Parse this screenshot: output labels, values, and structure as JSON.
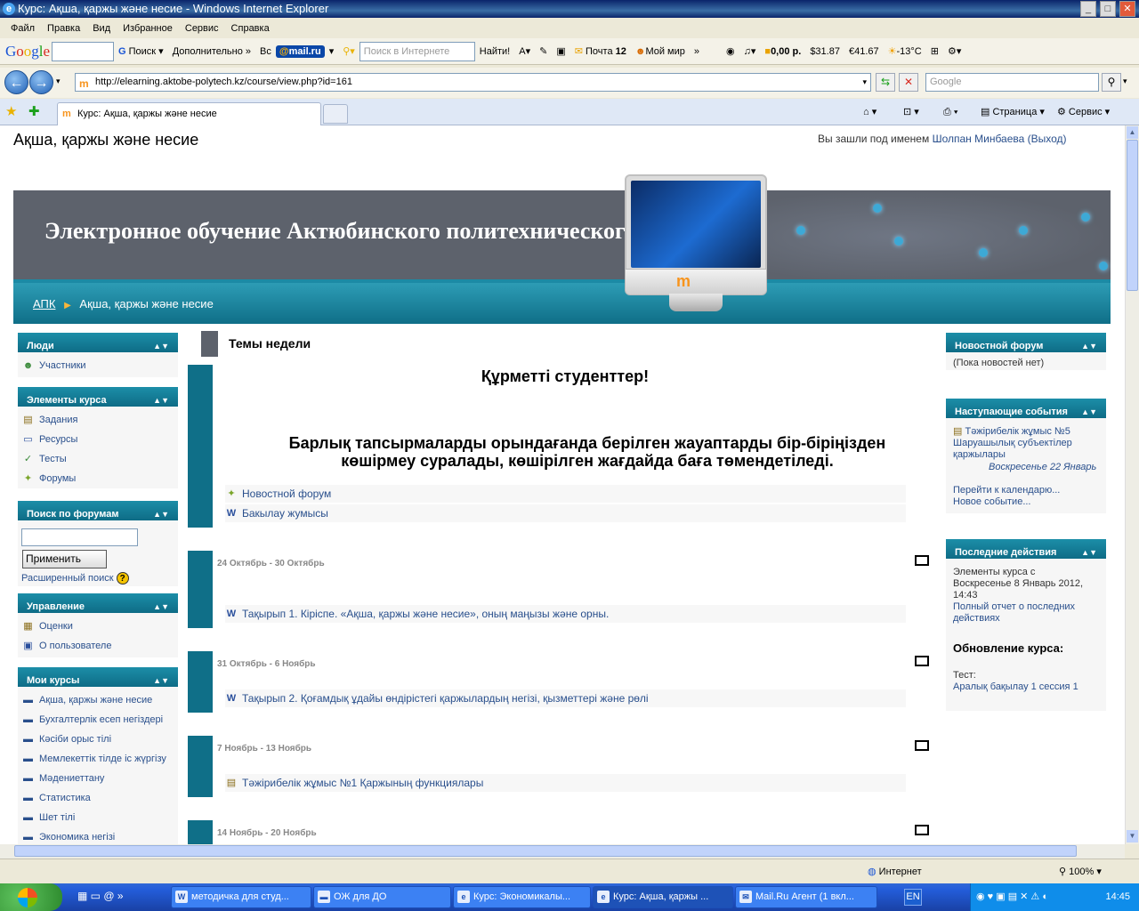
{
  "window": {
    "title": "Курс: Ақша, қаржы және несие - Windows Internet Explorer",
    "controls": [
      "_",
      "□",
      "✕"
    ]
  },
  "menu": [
    "Файл",
    "Правка",
    "Вид",
    "Избранное",
    "Сервис",
    "Справка"
  ],
  "toolbar": {
    "google": "Google",
    "search_btn": "Поиск",
    "more": "Дополнительно »",
    "vs": "Вс",
    "mailru": "mail.ru",
    "search_placeholder": "Поиск в Интернете",
    "find": "Найти!",
    "mail": "Почта",
    "mail_count": "12",
    "myworld": "Мой мир",
    "money": "0,00 р.",
    "usd": "$31.87",
    "eur": "€41.67",
    "weather": "-13°C"
  },
  "address": {
    "url": "http://elearning.aktobe-polytech.kz/course/view.php?id=161",
    "search_placeholder": "Google"
  },
  "tabs": {
    "active": "Курс: Ақша, қаржы және несие",
    "page_menu": "Страница",
    "tools_menu": "Сервис"
  },
  "course": {
    "title": "Ақша, қаржы және несие",
    "login_prefix": "Вы зашли под именем",
    "user": "Шолпан Минбаева",
    "logout": "(Выход)",
    "banner": "Электронное обучение Актюбинского политехнического колледжа",
    "crumb_home": "АПК",
    "crumb_current": "Ақша, қаржы және несие"
  },
  "left": {
    "people": {
      "title": "Люди",
      "items": [
        "Участники"
      ]
    },
    "elements": {
      "title": "Элементы курса",
      "items": [
        "Задания",
        "Ресурсы",
        "Тесты",
        "Форумы"
      ]
    },
    "search": {
      "title": "Поиск по форумам",
      "button": "Применить",
      "advanced": "Расширенный поиск"
    },
    "admin": {
      "title": "Управление",
      "items": [
        "Оценки",
        "О пользователе"
      ]
    },
    "mycourses": {
      "title": "Мои курсы",
      "items": [
        "Ақша, қаржы және несие",
        "Бухгалтерлік есеп негіздері",
        "Кәсіби орыс тілі",
        "Мемлекеттік тілде іс жүргізу",
        "Мәдениеттану",
        "Статистика",
        "Шет тілі",
        "Экономика негізі"
      ]
    }
  },
  "main": {
    "heading": "Темы недели",
    "greeting": "Құрметті студенттер!",
    "notice": "Барлық тапсырмаларды орындағанда берілген жауаптарды бір-біріңізден көшірмеу суралады, көшірілген жағдайда баға төмендетіледі.",
    "intro_items": [
      "Новостной форум",
      "Бакылау жумысы"
    ],
    "weeks": [
      {
        "dates": "24 Октябрь - 30 Октябрь",
        "item": "Тақырып 1. Кіріспе. «Ақша, қаржы және несие», оның маңызы және орны."
      },
      {
        "dates": "31 Октябрь - 6 Ноябрь",
        "item": "Тақырып 2. Қоғамдық ұдайы өндірістегі қаржылардың негізі, қызметтері және рөлі"
      },
      {
        "dates": "7 Ноябрь - 13 Ноябрь",
        "item": "Тәжірибелік жұмыс №1 Қаржының функциялары"
      },
      {
        "dates": "14 Ноябрь - 20 Ноябрь",
        "item": ""
      }
    ]
  },
  "right": {
    "news": {
      "title": "Новостной форум",
      "empty": "(Пока новостей нет)"
    },
    "events": {
      "title": "Наступающие события",
      "event_line1": "Тәжірибелік жұмыс №5",
      "event_line2": "Шаруашылық субъектілер",
      "event_line3": "қаржылары",
      "event_date": "Воскресенье 22 Январь",
      "calendar": "Перейти к календарю...",
      "new_event": "Новое событие..."
    },
    "recent": {
      "title": "Последние действия",
      "since1": "Элементы курса с",
      "since2": "Воскресенье 8 Январь 2012,",
      "since3": "14:43",
      "full1": "Полный отчет о последних",
      "full2": "действиях",
      "updates": "Обновление курса:",
      "test_label": "Тест:",
      "test_item": "Аралық бақылау 1 сессия 1"
    }
  },
  "status": {
    "zone": "Интернет",
    "zoom": "100%"
  },
  "taskbar": {
    "tasks": [
      "методичка для студ...",
      "ОЖ для ДО",
      "Курс: Экономикалы...",
      "Курс: Ақша, қаржы ...",
      "Mail.Ru Агент (1 вкл..."
    ],
    "lang": "EN",
    "time": "14:45"
  }
}
